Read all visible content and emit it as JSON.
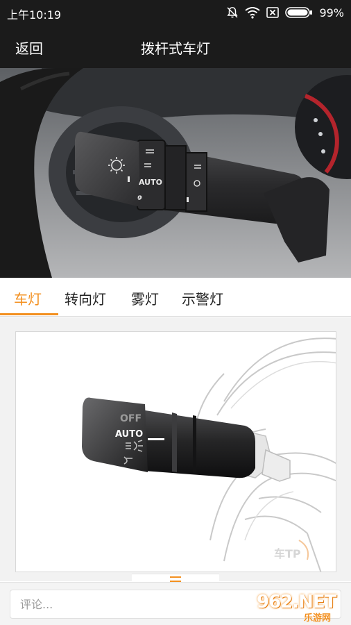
{
  "status_bar": {
    "time": "上午10:19",
    "battery": "99%",
    "icons": [
      "mute-bell-icon",
      "wifi-icon",
      "sim-x-icon",
      "battery-icon"
    ]
  },
  "nav": {
    "back_label": "返回",
    "title": "拨杆式车灯"
  },
  "hero": {
    "image": "headlight-stalk-photo",
    "stalk_labels": {
      "auto": "AUTO",
      "off": "0"
    }
  },
  "tabs": [
    {
      "label": "车灯",
      "active": true
    },
    {
      "label": "转向灯",
      "active": false
    },
    {
      "label": "雾灯",
      "active": false
    },
    {
      "label": "示警灯",
      "active": false
    }
  ],
  "diagram": {
    "image": "light-switch-diagram",
    "switch_labels": {
      "off": "OFF",
      "auto": "AUTO"
    },
    "logo_text": "车TP"
  },
  "comment": {
    "placeholder": "评论..."
  },
  "watermark": {
    "main": "962.NET",
    "sub": "乐游网"
  },
  "colors": {
    "accent": "#f39020",
    "bar_background": "#1b1b1b"
  }
}
